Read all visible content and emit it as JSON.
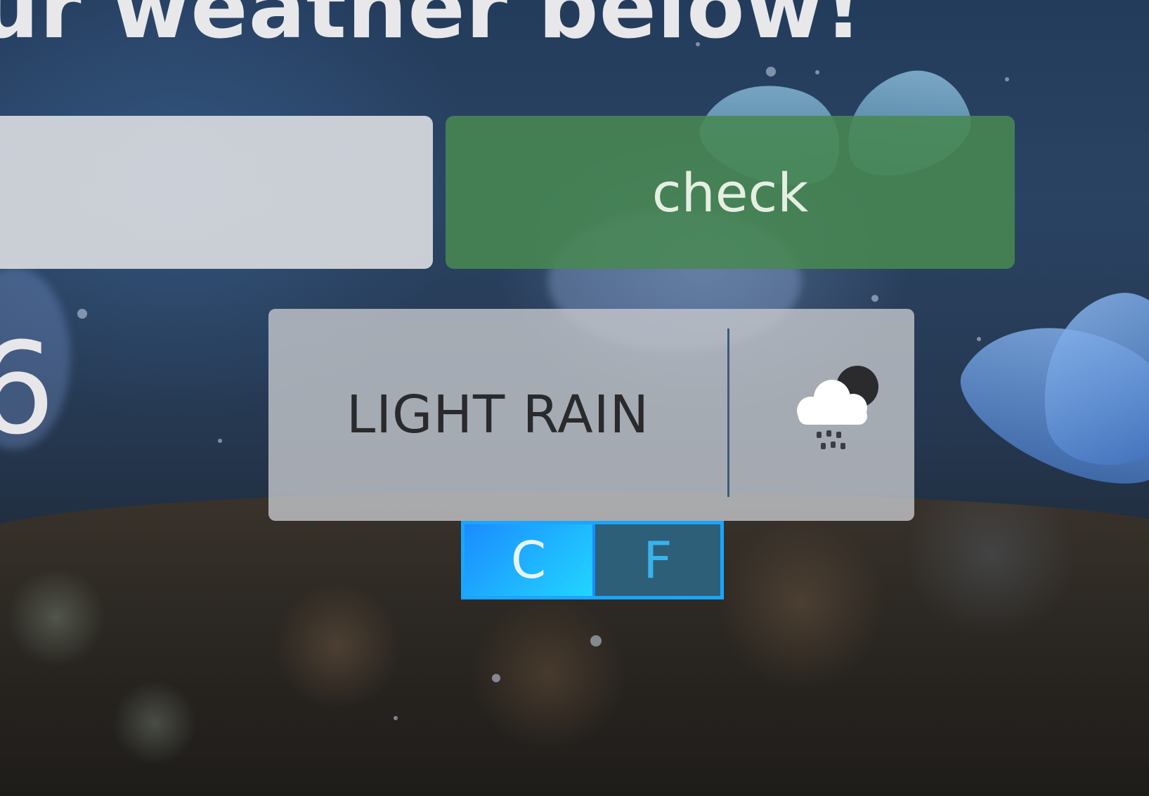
{
  "header": {
    "title": "ur weather below!"
  },
  "search": {
    "input_value": "",
    "check_label": "check"
  },
  "current": {
    "temperature_partial": "6",
    "description": "LIGHT RAIN",
    "icon": "cloud-rain-night-icon"
  },
  "units": {
    "celsius_label": "C",
    "fahrenheit_label": "F",
    "selected": "C"
  },
  "colors": {
    "check_button": "#488752",
    "toggle_active": "#1fb8ff",
    "toggle_inactive": "#2d5f78",
    "toggle_border": "#1aa6ff"
  }
}
